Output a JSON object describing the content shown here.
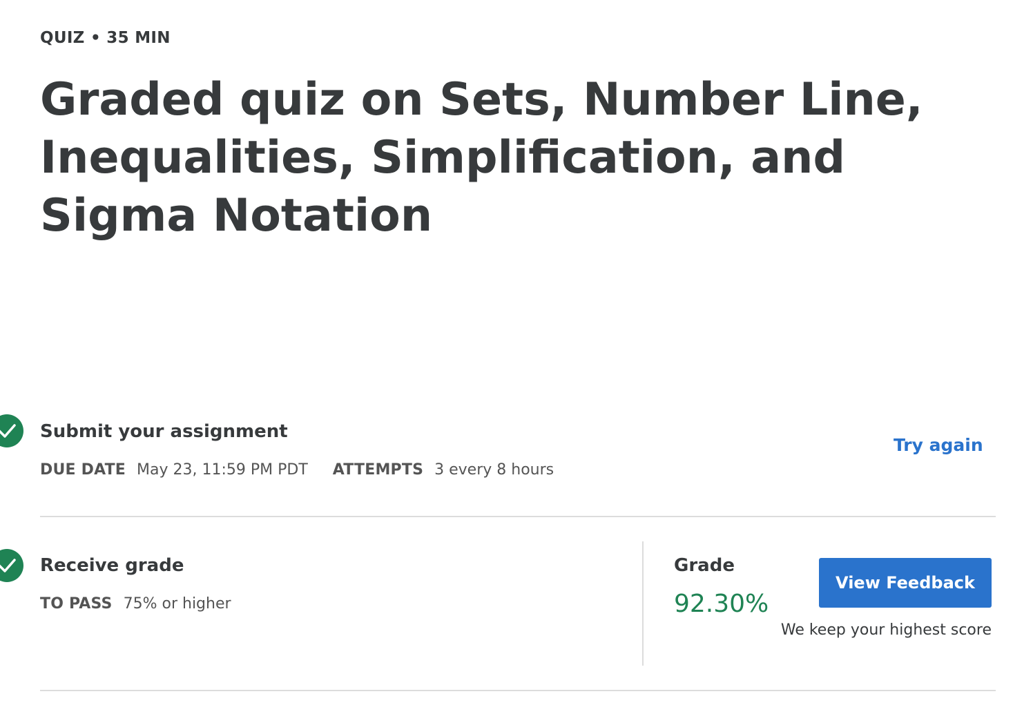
{
  "header": {
    "meta": "QUIZ • 35 MIN",
    "title": "Graded quiz on Sets, Number Line, Inequalities, Simplification, and Sigma Notation"
  },
  "submit_section": {
    "heading": "Submit your assignment",
    "due_date_label": "DUE DATE",
    "due_date_value": "May 23, 11:59 PM PDT",
    "attempts_label": "ATTEMPTS",
    "attempts_value": "3 every 8 hours",
    "try_again_label": "Try again",
    "status_icon": "check-circle-icon"
  },
  "grade_section": {
    "heading": "Receive grade",
    "to_pass_label": "TO PASS",
    "to_pass_value": "75% or higher",
    "grade_label": "Grade",
    "grade_value": "92.30%",
    "view_feedback_label": "View Feedback",
    "highest_score_note": "We keep your highest score",
    "status_icon": "check-circle-icon"
  },
  "colors": {
    "accent": "#2a73cc",
    "success": "#1f8354",
    "text": "#373a3c",
    "divider": "#dcdcdc"
  }
}
